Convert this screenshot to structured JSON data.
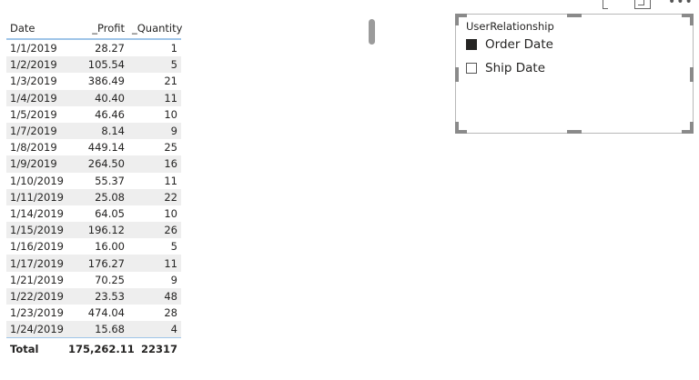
{
  "table": {
    "headers": [
      "Date",
      "_Profit",
      "_Quantity"
    ],
    "rows": [
      [
        "1/1/2019",
        "28.27",
        "1"
      ],
      [
        "1/2/2019",
        "105.54",
        "5"
      ],
      [
        "1/3/2019",
        "386.49",
        "21"
      ],
      [
        "1/4/2019",
        "40.40",
        "11"
      ],
      [
        "1/5/2019",
        "46.46",
        "10"
      ],
      [
        "1/7/2019",
        "8.14",
        "9"
      ],
      [
        "1/8/2019",
        "449.14",
        "25"
      ],
      [
        "1/9/2019",
        "264.50",
        "16"
      ],
      [
        "1/10/2019",
        "55.37",
        "11"
      ],
      [
        "1/11/2019",
        "25.08",
        "22"
      ],
      [
        "1/14/2019",
        "64.05",
        "10"
      ],
      [
        "1/15/2019",
        "196.12",
        "26"
      ],
      [
        "1/16/2019",
        "16.00",
        "5"
      ],
      [
        "1/17/2019",
        "176.27",
        "11"
      ],
      [
        "1/21/2019",
        "70.25",
        "9"
      ],
      [
        "1/22/2019",
        "23.53",
        "48"
      ],
      [
        "1/23/2019",
        "474.04",
        "28"
      ],
      [
        "1/24/2019",
        "15.68",
        "4"
      ]
    ],
    "total": [
      "Total",
      "175,262.11",
      "22317"
    ]
  },
  "slicer": {
    "title": "UserRelationship",
    "items": [
      {
        "label": "Order Date",
        "checked": true
      },
      {
        "label": "Ship Date",
        "checked": false
      }
    ]
  },
  "visual_header": {
    "icons": [
      "pin-icon",
      "focus-mode-icon",
      "more-options-icon"
    ]
  },
  "colors": {
    "accent_border": "#9fc5e8",
    "banded_row": "#eeeeee",
    "handle": "#8a8a8a"
  }
}
